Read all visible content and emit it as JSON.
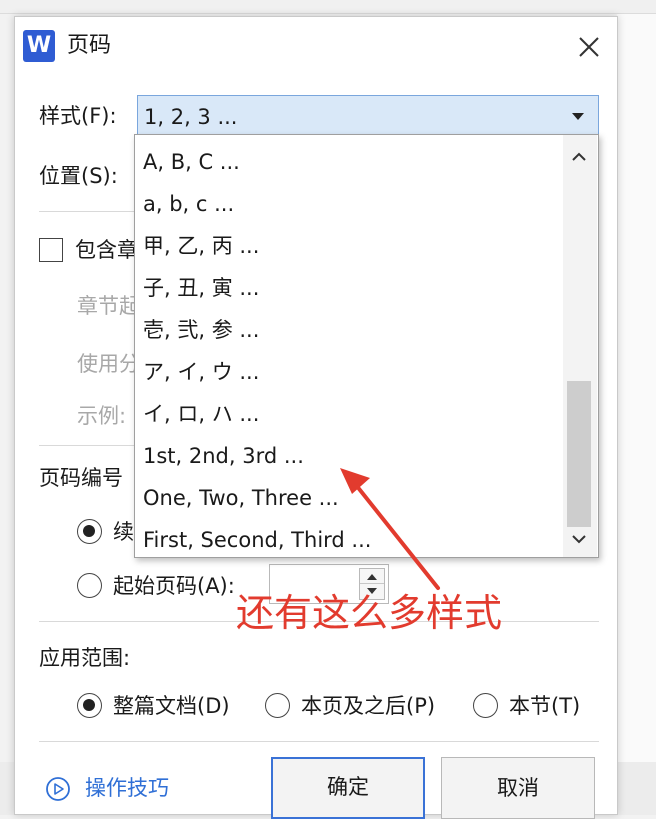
{
  "dialog": {
    "title": "页码",
    "app_logo": "W",
    "close_icon": "close-icon"
  },
  "style_row": {
    "label": "样式(F):",
    "value": "1, 2, 3 ..."
  },
  "position_row": {
    "label": "位置(S):"
  },
  "include_chapter": {
    "label": "包含章",
    "checked": false
  },
  "chapter_start": {
    "label": "章节起"
  },
  "use_separator": {
    "label": "使用分"
  },
  "example": {
    "label": "示例:"
  },
  "numbering": {
    "label": "页码编号",
    "continue_label": "续",
    "continue_selected": true,
    "start_label": "起始页码(A):",
    "start_value": ""
  },
  "scope": {
    "label": "应用范围:",
    "options": [
      "整篇文档(D)",
      "本页及之后(P)",
      "本节(T)"
    ],
    "selected_index": 0
  },
  "tips_link": "操作技巧",
  "ok_label": "确定",
  "cancel_label": "取消",
  "dropdown": {
    "items": [
      "A, B, C ...",
      "a, b, c ...",
      "甲, 乙, 丙 ...",
      "子, 丑, 寅 ...",
      "壱, 弐, 参 ...",
      "ア, イ, ウ ...",
      "イ, ロ, ハ ...",
      "1st, 2nd, 3rd ...",
      "One, Two, Three ...",
      "First, Second, Third ..."
    ]
  },
  "annotation": {
    "text": "还有这么多样式",
    "color": "#e23b2e"
  },
  "colors": {
    "accent": "#2f6fd6",
    "combo_bg": "#d9e8f8",
    "logo": "#2f5cd3"
  }
}
